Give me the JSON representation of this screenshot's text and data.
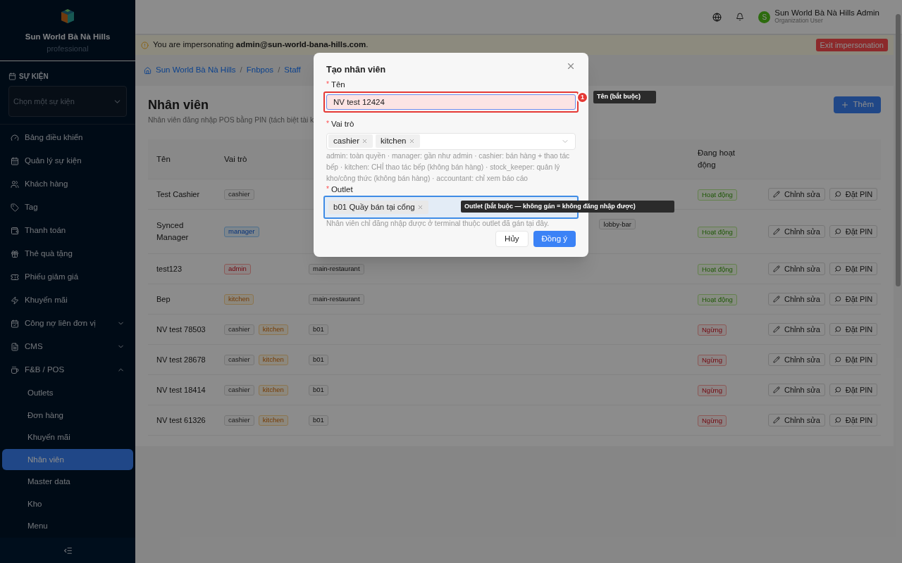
{
  "sidebar": {
    "brand": {
      "title": "Sun World Bà Nà Hills",
      "subtitle": "professional"
    },
    "event_section": {
      "label": "SỰ KIỆN",
      "select_placeholder": "Chọn một sự kiện"
    },
    "items": [
      {
        "label": "Bảng điều khiển"
      },
      {
        "label": "Quản lý sự kiện"
      },
      {
        "label": "Khách hàng"
      },
      {
        "label": "Tag"
      },
      {
        "label": "Thanh toán"
      },
      {
        "label": "Thẻ quà tặng"
      },
      {
        "label": "Phiếu giảm giá"
      },
      {
        "label": "Khuyến mãi"
      },
      {
        "label": "Công nợ liên đơn vị",
        "expanded": false
      },
      {
        "label": "CMS",
        "expanded": false
      },
      {
        "label": "F&B / POS",
        "expanded": true,
        "children": [
          {
            "label": "Outlets",
            "selected": false
          },
          {
            "label": "Đơn hàng",
            "selected": false
          },
          {
            "label": "Khuyến mãi",
            "selected": false
          },
          {
            "label": "Nhân viên",
            "selected": true
          },
          {
            "label": "Master data",
            "selected": false
          },
          {
            "label": "Kho",
            "selected": false
          },
          {
            "label": "Menu",
            "selected": false
          }
        ]
      }
    ]
  },
  "header": {
    "user_name": "Sun World Bà Nà Hills Admin",
    "user_role": "Organization User",
    "avatar": "S"
  },
  "banner": {
    "text": "You are impersonating **admin@sun-world-bana-hills.com**.",
    "button": "Exit impersonation"
  },
  "breadcrumb": [
    {
      "kind": "link",
      "text": "Sun World Bà Nà Hills"
    },
    {
      "kind": "separator",
      "text": "/"
    },
    {
      "kind": "link",
      "text": "Fnbpos"
    },
    {
      "kind": "separator",
      "text": "/"
    },
    {
      "kind": "link",
      "text": "Staff"
    }
  ],
  "page": {
    "title": "Nhân viên",
    "subtitle": "Nhân viên đăng nhập POS bằng PIN (tách biệt tài k",
    "add_button": "Thêm"
  },
  "table": {
    "columns": [
      "Tên",
      "Vai trò",
      "Đang hoạt động"
    ],
    "rows": [
      {
        "name": "Test Cashier",
        "roles": [
          {
            "label": "cashier",
            "kind": "cashier"
          }
        ],
        "outlets": [],
        "active": true,
        "status": "Hoạt động",
        "actions": [
          "Chỉnh sửa",
          "Đặt PIN"
        ]
      },
      {
        "name": "Synced Manager",
        "roles": [
          {
            "label": "manager",
            "kind": "manager"
          }
        ],
        "outlets": [
          "lobby-bar"
        ],
        "outlets_partly_hidden": true,
        "active": true,
        "status": "Hoạt động",
        "actions": [
          "Chỉnh sửa",
          "Đặt PIN"
        ]
      },
      {
        "name": "test123",
        "roles": [
          {
            "label": "admin",
            "kind": "admin"
          }
        ],
        "outlets": [
          "main-restaurant"
        ],
        "active": true,
        "status": "Hoạt động",
        "actions": [
          "Chỉnh sửa",
          "Đặt PIN"
        ]
      },
      {
        "name": "Bep",
        "roles": [
          {
            "label": "kitchen",
            "kind": "kitchen"
          }
        ],
        "outlets": [
          "main-restaurant"
        ],
        "active": true,
        "status": "Hoạt động",
        "actions": [
          "Chỉnh sửa",
          "Đặt PIN"
        ]
      },
      {
        "name": "NV test 78503",
        "roles": [
          {
            "label": "cashier",
            "kind": "cashier"
          },
          {
            "label": "kitchen",
            "kind": "kitchen"
          }
        ],
        "outlets": [
          "b01"
        ],
        "active": false,
        "status": "Ngừng",
        "actions": [
          "Chỉnh sửa",
          "Đặt PIN"
        ]
      },
      {
        "name": "NV test 28678",
        "roles": [
          {
            "label": "cashier",
            "kind": "cashier"
          },
          {
            "label": "kitchen",
            "kind": "kitchen"
          }
        ],
        "outlets": [
          "b01"
        ],
        "active": false,
        "status": "Ngừng",
        "actions": [
          "Chỉnh sửa",
          "Đặt PIN"
        ]
      },
      {
        "name": "NV test 18414",
        "roles": [
          {
            "label": "cashier",
            "kind": "cashier"
          },
          {
            "label": "kitchen",
            "kind": "kitchen"
          }
        ],
        "outlets": [
          "b01"
        ],
        "active": false,
        "status": "Ngừng",
        "actions": [
          "Chỉnh sửa",
          "Đặt PIN"
        ]
      },
      {
        "name": "NV test 61326",
        "roles": [
          {
            "label": "cashier",
            "kind": "cashier"
          },
          {
            "label": "kitchen",
            "kind": "kitchen"
          }
        ],
        "outlets": [
          "b01"
        ],
        "active": false,
        "status": "Ngừng",
        "actions": [
          "Chỉnh sửa",
          "Đặt PIN"
        ]
      }
    ]
  },
  "dialog": {
    "title": "Tạo nhân viên",
    "name_field": {
      "required_mark": "*",
      "label": "Tên",
      "value": "NV test 12424"
    },
    "roles_field": {
      "required_mark": "*",
      "label": "Vai trò",
      "tags": [
        "cashier",
        "kitchen"
      ],
      "help": "admin: toàn quyền · manager: gần như admin · cashier: bán hàng + thao tác bếp · kitchen: CHỈ thao tác bếp (không bán hàng) · stock_keeper: quản lý kho/công thức (không bán hàng) · accountant: chỉ xem báo cáo"
    },
    "outlet_field": {
      "required_mark": "*",
      "label": "Outlet",
      "tags": [
        "b01 Quầy bán tại cổng"
      ],
      "help": "Nhân viên chỉ đăng nhập được ở terminal thuộc outlet đã gán tại đây."
    },
    "cancel": "Hủy",
    "ok": "Đồng ý"
  },
  "annotations": [
    {
      "number": "1",
      "tooltip": "Tên (bắt buộc)"
    },
    {
      "tooltip": "Outlet (bắt buộc — không gán = không đăng nhập được)"
    }
  ]
}
